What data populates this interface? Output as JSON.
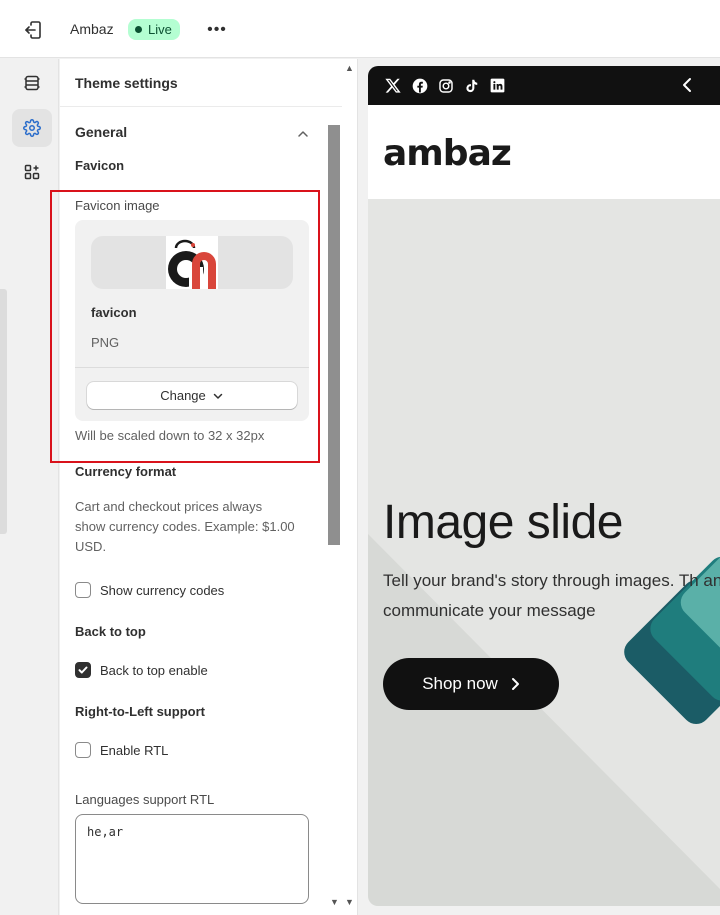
{
  "topbar": {
    "store_name": "Ambaz",
    "status_badge": "Live",
    "more_label": "•••"
  },
  "panel": {
    "title": "Theme settings",
    "section": "General",
    "favicon": {
      "heading": "Favicon",
      "field_label": "Favicon image",
      "file_name": "favicon",
      "file_type": "PNG",
      "change_label": "Change",
      "help": "Will be scaled down to 32 x 32px"
    },
    "currency": {
      "heading": "Currency format",
      "help": "Cart and checkout prices always show currency codes. Example: $1.00 USD.",
      "checkbox_label": "Show currency codes",
      "checked": false
    },
    "back_to_top": {
      "heading": "Back to top",
      "checkbox_label": "Back to top enable",
      "checked": true
    },
    "rtl": {
      "heading": "Right-to-Left support",
      "checkbox_label": "Enable RTL",
      "checked": false,
      "languages_label": "Languages support RTL",
      "languages_value": "he,ar"
    }
  },
  "preview": {
    "social_icons": [
      "x-icon",
      "facebook-icon",
      "instagram-icon",
      "tiktok-icon",
      "linkedin-icon"
    ],
    "logo_text": "ambaz",
    "hero": {
      "title": "Image slide",
      "text": "Tell your brand's story through images. Th and communicate your message",
      "button_label": "Shop now"
    }
  },
  "colors": {
    "highlight_box": "#d9121b",
    "live_badge_bg": "#b4fed2",
    "hero_bg": "#e4e5e3",
    "teal_1": "#5ab0a8",
    "teal_2": "#1f7d7d",
    "teal_3": "#1b5c66"
  }
}
